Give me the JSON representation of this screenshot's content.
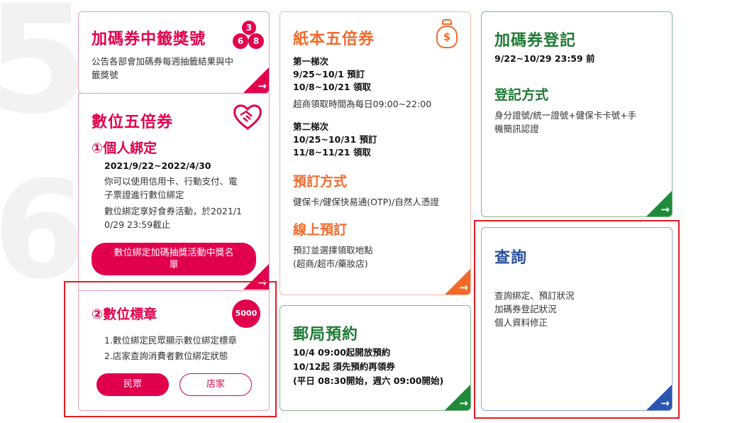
{
  "background_marks": {
    "top": "5",
    "mid": "6"
  },
  "lottery": {
    "title": "加碼券中籤獎號",
    "desc_line1": "公告各部會加碼券每週抽籤結果與中",
    "desc_line2": "籤獎號",
    "badge": {
      "n1": "3",
      "n2": "6",
      "n3": "8"
    }
  },
  "digital": {
    "title": "數位五倍券",
    "bind_title": "①個人綁定",
    "period": "2021/9/22~2022/4/30",
    "line1": "你可以使用信用卡、行動支付、電",
    "line2": "子票證進行數位綁定",
    "line3": "數位綁定享好食券活動，於2021/1",
    "line4": "0/29 23:59截止",
    "winner_btn_l1": "數位綁定加碼抽獎活動中獎名",
    "winner_btn_l2": "單",
    "badge_title": "②數位標章",
    "badge_line1": "1.數位綁定民眾顯示數位綁定標章",
    "badge_line2": "2.店家查詢消費者數位綁定狀態",
    "public_btn": "民眾",
    "store_btn": "店家",
    "logo_text": "5000"
  },
  "paper": {
    "title": "紙本五倍券",
    "batch1": "第一梯次",
    "b1_order": "9/25~10/1 預訂",
    "b1_pick": "10/8~10/21 領取",
    "b1_note": "超商領取時間為每日09:00~22:00",
    "batch2": "第二梯次",
    "b2_order": "10/25~10/31 預訂",
    "b2_pick": "11/8~11/21 領取",
    "method_title": "預訂方式",
    "method_text": "健保卡/健保快易通(OTP)/自然人憑證",
    "online_title": "線上預訂",
    "online_l1": "預訂並選擇領取地點",
    "online_l2": "(超商/超市/藥妝店)",
    "money_icon_char": "$"
  },
  "post": {
    "title": "郵局預約",
    "l1": "10/4 09:00起開放預約",
    "l2": "10/12起 須先預約再領券",
    "l3": "(平日 08:30開始，週六 09:00開始)"
  },
  "register": {
    "title": "加碼券登記",
    "deadline": "9/22~10/29 23:59 前",
    "method_title": "登記方式",
    "method_l1": "身分證號/統一證號+健保卡卡號+手",
    "method_l2": "機簡訊認證"
  },
  "query": {
    "title": "查詢",
    "l1": "查詢綁定、預訂狀況",
    "l2": "加碼券登記狀況",
    "l3": "個人資料修正"
  },
  "arrow_char": "→",
  "colors": {
    "red": "#e0004d",
    "orange": "#f06a2a",
    "green": "#1f8a3a",
    "blue": "#2a56b0",
    "highlight": "#e21b23"
  }
}
